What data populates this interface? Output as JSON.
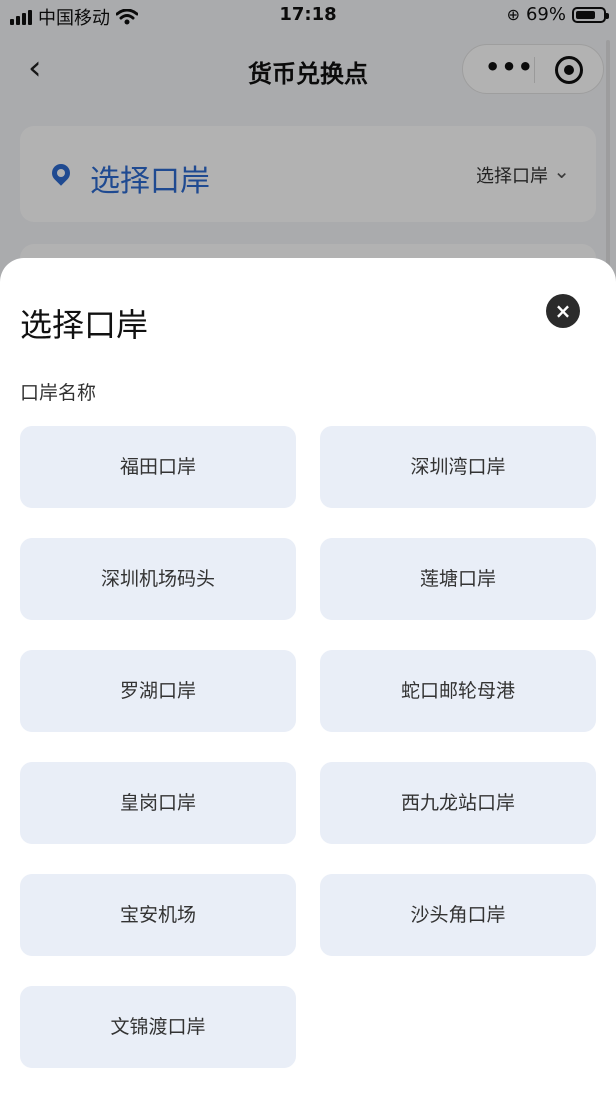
{
  "status": {
    "carrier": "中国移动",
    "time": "17:18",
    "battery": "69%"
  },
  "nav": {
    "back": "‹",
    "title": "货币兑换点",
    "more": "•••"
  },
  "background_card": {
    "title": "选择口岸",
    "select_label": "选择口岸",
    "chevron": "⌄"
  },
  "sheet": {
    "title": "选择口岸",
    "close": "×",
    "section_label": "口岸名称",
    "options": [
      "福田口岸",
      "深圳湾口岸",
      "深圳机场码头",
      "莲塘口岸",
      "罗湖口岸",
      "蛇口邮轮母港",
      "皇岗口岸",
      "西九龙站口岸",
      "宝安机场",
      "沙头角口岸",
      "文锦渡口岸"
    ]
  },
  "colors": {
    "accent": "#2d6bd0",
    "option_bg": "#e9eef7"
  }
}
